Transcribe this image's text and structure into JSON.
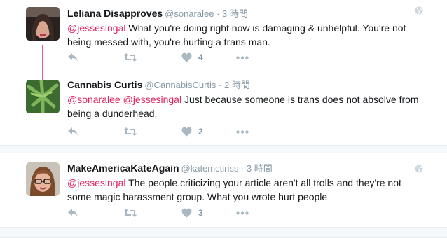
{
  "tweets": [
    {
      "name": "Leliana Disapproves",
      "handle": "@sonaralee",
      "sep": " · ",
      "time": "3 時間",
      "mentions": [
        "@jessesingal"
      ],
      "text": " What you're doing right now is damaging & unhelpful. You're not being messed with, you're hurting a trans man.",
      "likes": "4"
    },
    {
      "name": "Cannabis Curtis",
      "handle": "@CannabisCurtis",
      "sep": " · ",
      "time": "2 時間",
      "mentions": [
        "@sonaralee",
        "@jessesingal"
      ],
      "text": " Just because someone is trans does not absolve from being a dunderhead.",
      "likes": "2"
    },
    {
      "name": "MakeAmericaKateAgain",
      "handle": "@katemctiriss",
      "sep": " · ",
      "time": "3 時間",
      "mentions": [
        "@jessesingal"
      ],
      "text": " The people criticizing your article aren't all trolls and they're not some magic harassment group. What you wrote hurt people",
      "likes": "3"
    }
  ],
  "colors": {
    "accent": "#e0245e",
    "muted": "#8899a6",
    "icon": "#aab8c2"
  },
  "icons": [
    "reply-icon",
    "retweet-icon",
    "like-icon",
    "more-icon",
    "globe-icon"
  ]
}
